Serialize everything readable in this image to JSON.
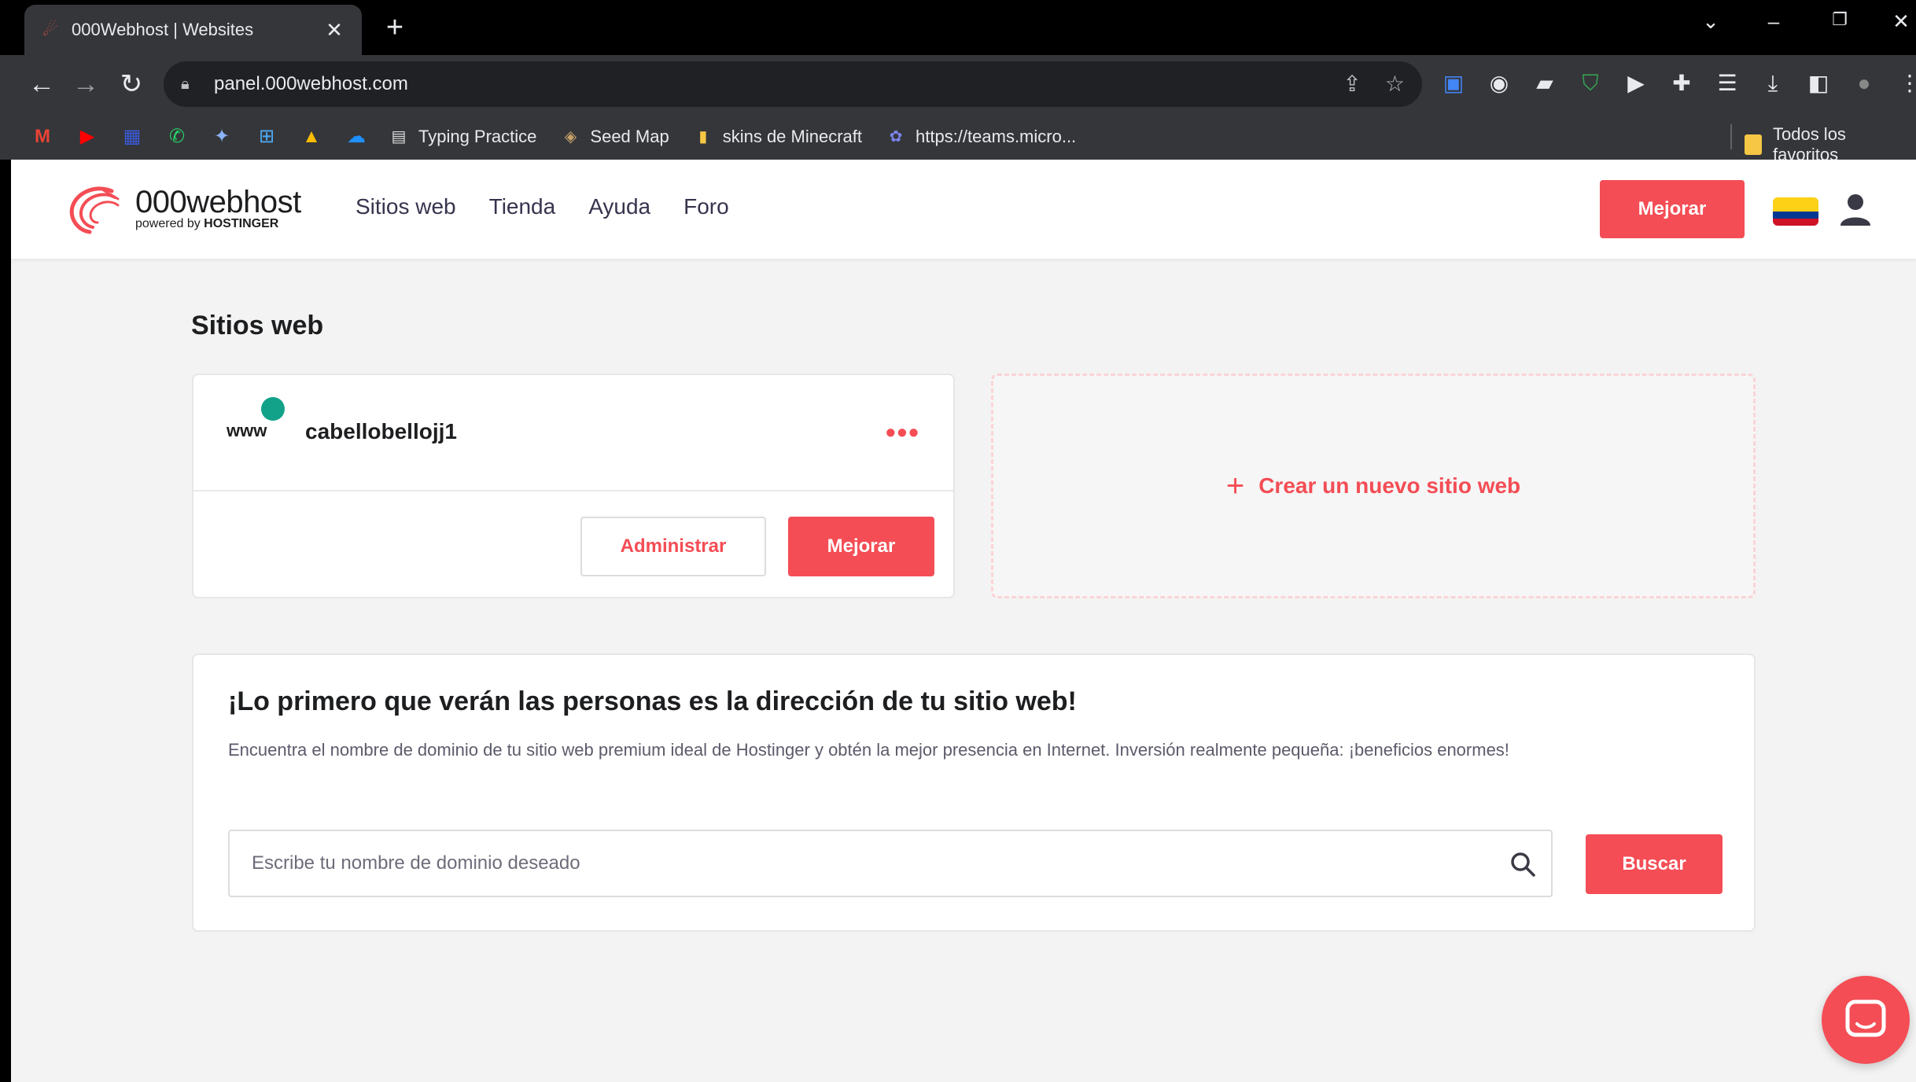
{
  "browser": {
    "tab": {
      "title": "000Webhost | Websites",
      "close": "✕"
    },
    "new_tab": "+",
    "window_controls": {
      "collapse": "⌄",
      "minimize": "–",
      "restore": "❐",
      "close": "✕"
    },
    "nav": {
      "back": "←",
      "forward": "→",
      "reload": "↻"
    },
    "url": "panel.000webhost.com",
    "bookmarks": [
      {
        "label": "Typing Practice",
        "icon": "page-icon"
      },
      {
        "label": "Seed Map",
        "icon": "seed-icon"
      },
      {
        "label": "skins de Minecraft",
        "icon": "folder-icon"
      },
      {
        "label": "https://teams.micro...",
        "icon": "teams-icon"
      }
    ],
    "all_bookmarks": "Todos los favoritos"
  },
  "header": {
    "logo": {
      "name": "000webhost",
      "powered": "powered by",
      "brand": "HOSTINGER"
    },
    "nav": [
      "Sitios web",
      "Tienda",
      "Ayuda",
      "Foro"
    ],
    "upgrade": "Mejorar"
  },
  "sites": {
    "heading": "Sitios web",
    "card": {
      "prefix": "www",
      "name": "cabellobellojj1",
      "menu": "•••",
      "admin": "Administrar",
      "upgrade": "Mejorar"
    },
    "create": {
      "plus": "+",
      "label": "Crear un nuevo sitio web"
    }
  },
  "domain": {
    "title": "¡Lo primero que verán las personas es la dirección de tu sitio web!",
    "description": "Encuentra el nombre de dominio de tu sitio web premium ideal de Hostinger y obtén la mejor presencia en Internet. Inversión realmente pequeña: ¡beneficios enormes!",
    "placeholder": "Escribe tu nombre de dominio deseado",
    "search": "Buscar"
  },
  "colors": {
    "accent": "#f44d55",
    "status": "#12a28a"
  }
}
